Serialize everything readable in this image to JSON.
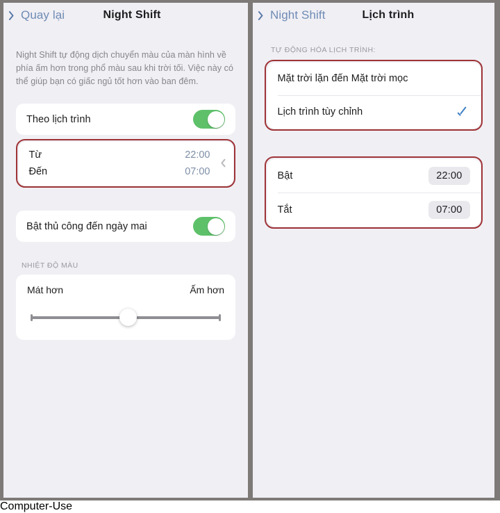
{
  "left_panel": {
    "nav": {
      "back_label": "Quay lại",
      "back_icon": "chevron-left-icon",
      "title": "Night Shift"
    },
    "description": "Night Shift tự động dịch chuyển màu của màn hình về phía ấm hơn trong phổ màu sau khi trời tối. Việc này có thể giúp bạn có giấc ngủ tốt hơn vào ban đêm.",
    "scheduled_row": {
      "label": "Theo lịch trình",
      "toggle_state": "on"
    },
    "time_range_row": {
      "from_label": "Từ",
      "from_value": "22:00",
      "to_label": "Đến",
      "to_value": "07:00",
      "disclosure_icon": "chevron-right-icon",
      "highlighted": true
    },
    "manual_row": {
      "label": "Bật thủ công đến ngày mai",
      "toggle_state": "on"
    },
    "temperature": {
      "group_header": "NHIỆT ĐỘ MÀU",
      "cooler_label": "Mát hơn",
      "warmer_label": "Ấm hơn",
      "slider_percent": 47
    }
  },
  "right_panel": {
    "nav": {
      "back_label": "Night Shift",
      "back_icon": "chevron-left-icon",
      "title": "Lịch trình"
    },
    "automation": {
      "group_header": "TỰ ĐỘNG HÓA LỊCH TRÌNH:",
      "highlighted": true,
      "options": [
        {
          "label": "Mặt trời lặn đến Mặt trời mọc",
          "selected": false
        },
        {
          "label": "Lịch trình tùy chỉnh",
          "selected": true,
          "check_icon": "checkmark-icon"
        }
      ]
    },
    "custom_times": {
      "highlighted": true,
      "rows": [
        {
          "label": "Bật",
          "value": "22:00"
        },
        {
          "label": "Tắt",
          "value": "07:00"
        }
      ]
    }
  },
  "colors": {
    "accent_green": "#5ec16a",
    "accent_blue": "#3f7fc4",
    "link_blue": "#6e8bb5",
    "annotation_red": "#9e3336",
    "background": "#f0eff4",
    "frame_gray": "#7d7a78"
  }
}
